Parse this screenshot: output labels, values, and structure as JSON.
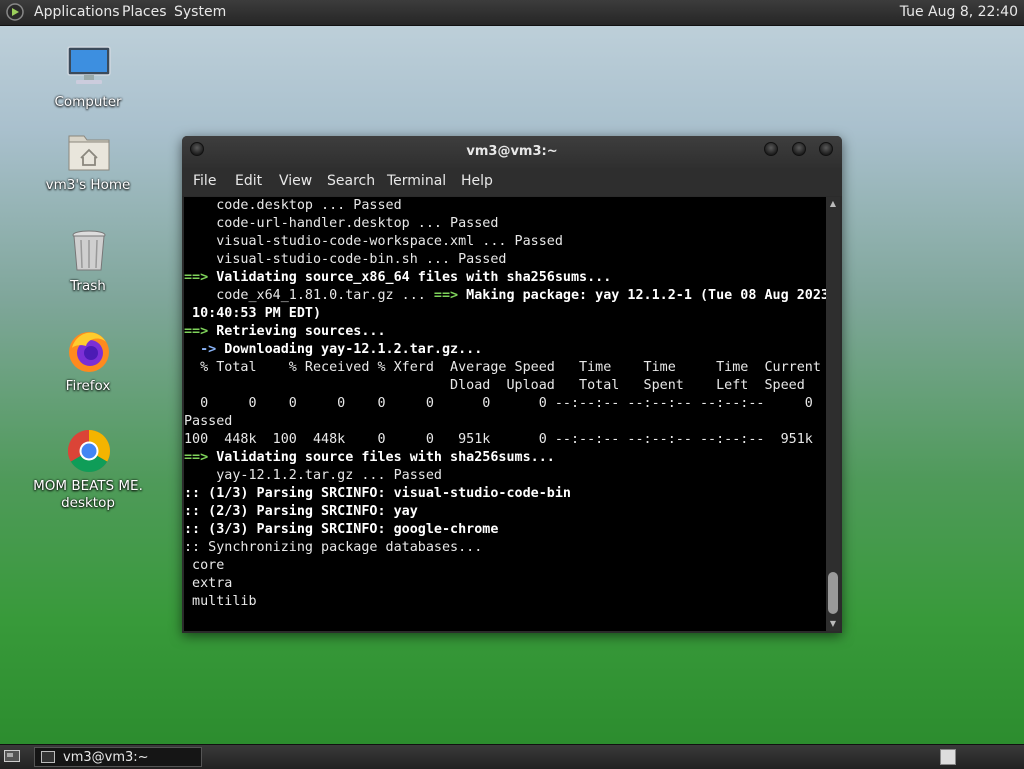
{
  "top_panel": {
    "menus": [
      "Applications",
      "Places",
      "System"
    ],
    "clock": "Tue Aug  8, 22:40"
  },
  "desktop_icons": [
    {
      "label": "Computer",
      "icon": "computer-icon"
    },
    {
      "label": "vm3's Home",
      "icon": "home-folder-icon"
    },
    {
      "label": "Trash",
      "icon": "trash-icon"
    },
    {
      "label": "Firefox",
      "icon": "firefox-icon"
    },
    {
      "label": "MOM BEATS ME.",
      "label2": "desktop",
      "icon": "chrome-icon"
    }
  ],
  "window": {
    "title": "vm3@vm3:~",
    "menu": [
      "File",
      "Edit",
      "View",
      "Search",
      "Terminal",
      "Help"
    ]
  },
  "terminal_lines": [
    "    code.desktop ... Passed",
    "    code-url-handler.desktop ... Passed",
    "    visual-studio-code-workspace.xml ... Passed",
    "    visual-studio-code-bin.sh ... Passed",
    "==> Validating source_x86_64 files with sha256sums...",
    "    code_x64_1.81.0.tar.gz ... ==> Making package: yay 12.1.2-1 (Tue 08 Aug 2023",
    " 10:40:53 PM EDT)",
    "==> Retrieving sources...",
    "  -> Downloading yay-12.1.2.tar.gz...",
    "  % Total    % Received % Xferd  Average Speed   Time    Time     Time  Current",
    "                                 Dload  Upload   Total   Spent    Left  Speed",
    "  0     0    0     0    0     0      0      0 --:--:-- --:--:-- --:--:--     0",
    "Passed",
    "100  448k  100  448k    0     0   951k      0 --:--:-- --:--:-- --:--:--  951k",
    "==> Validating source files with sha256sums...",
    "    yay-12.1.2.tar.gz ... Passed",
    ":: (1/3) Parsing SRCINFO: visual-studio-code-bin",
    ":: (2/3) Parsing SRCINFO: yay",
    ":: (3/3) Parsing SRCINFO: google-chrome",
    ":: Synchronizing package databases...",
    " core",
    " extra",
    " multilib"
  ],
  "taskbar": {
    "items": [
      {
        "label": "vm3@vm3:~",
        "icon": "terminal-icon"
      }
    ]
  },
  "colors": {
    "prompt_green": "#7fd35b",
    "prompt_blue": "#8ab4f8"
  }
}
